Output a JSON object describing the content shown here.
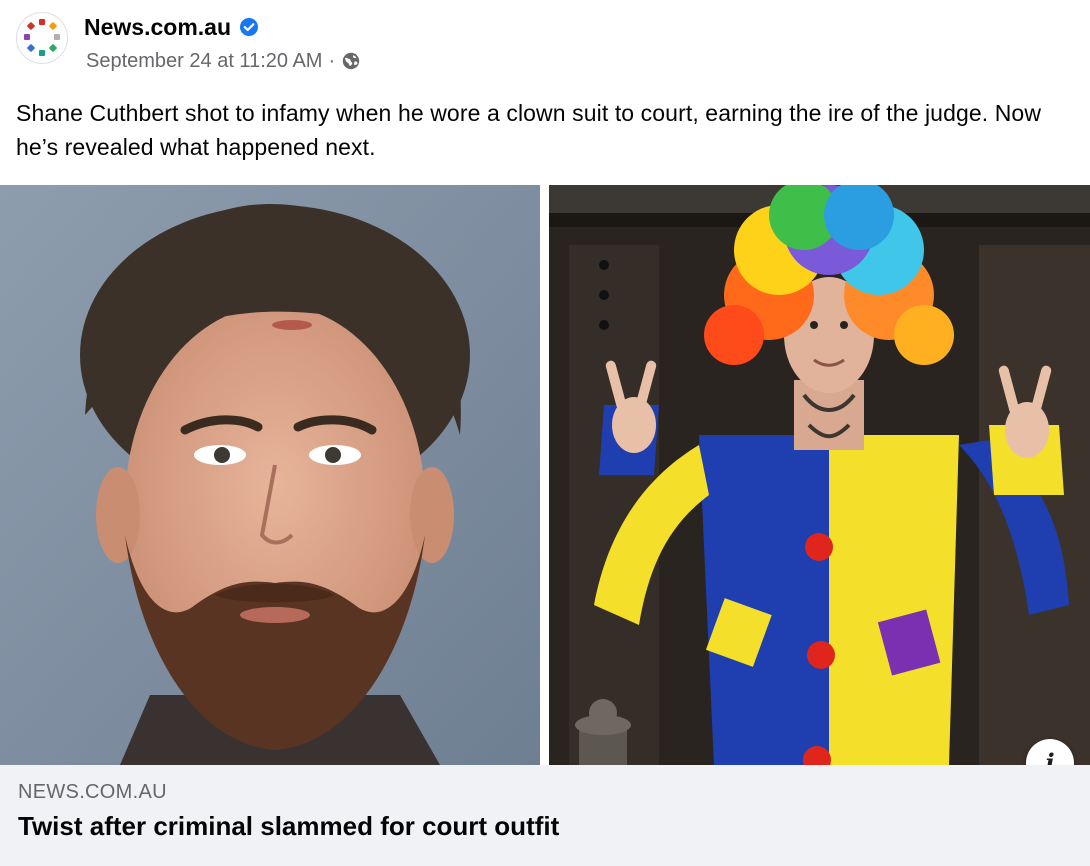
{
  "post": {
    "page_name": "News.com.au",
    "timestamp": "September 24 at 11:20 AM",
    "separator": "·",
    "audience_icon": "globe-icon",
    "verified_icon": "verified-badge-icon",
    "caption": "Shane Cuthbert shot to infamy when he wore a clown suit to court, earning the ire of the judge. Now he’s revealed what happened next.",
    "media": {
      "left_image": "mugshot-photo",
      "right_image": "clown-suit-photo",
      "info_icon": "info-icon",
      "info_glyph": "i"
    },
    "link": {
      "domain": "NEWS.COM.AU",
      "headline": "Twist after criminal slammed for court outfit"
    }
  },
  "colors": {
    "brand_blue": "#1877f2",
    "secondary_text": "#65676b",
    "link_box_bg": "#f0f2f5"
  }
}
